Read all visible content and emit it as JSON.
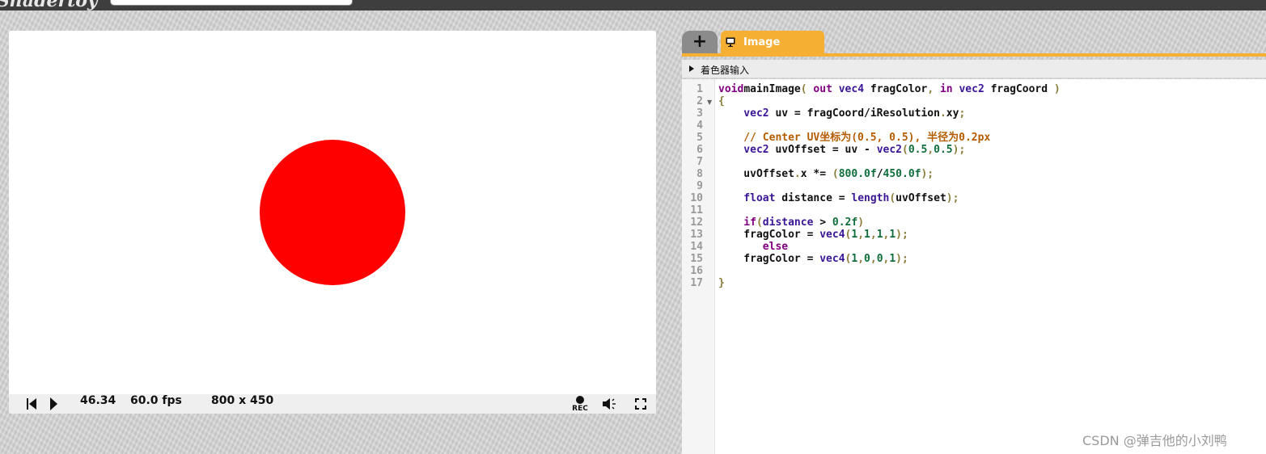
{
  "site": {
    "logo_fragment": "Shadertoy"
  },
  "player": {
    "time": "46.34",
    "fps": "60.0 fps",
    "resolution": "800 x 450",
    "rec_label": "REC",
    "circle_color": "#ff0000"
  },
  "editor": {
    "add_tab": "+",
    "tab_label": "Image",
    "input_header": "着色器输入",
    "accent": "#f5af32",
    "line_numbers": [
      "1",
      "2",
      "3",
      "4",
      "5",
      "6",
      "7",
      "8",
      "9",
      "10",
      "11",
      "12",
      "13",
      "14",
      "15",
      "16",
      "17"
    ],
    "code_lines": [
      [
        [
          "kw",
          "void"
        ],
        [
          "",
          "mainImage"
        ],
        [
          "pn",
          "( "
        ],
        [
          "kw",
          "out"
        ],
        [
          "",
          ""
        ],
        [
          "ty",
          " vec4"
        ],
        [
          "",
          " fragColor"
        ],
        [
          "pn",
          ","
        ],
        [
          "kw",
          " in"
        ],
        [
          "ty",
          " vec2"
        ],
        [
          "",
          " fragCoord "
        ],
        [
          "pn",
          ")"
        ]
      ],
      [
        [
          "pn",
          "{"
        ]
      ],
      [
        [
          "",
          ""
        ],
        [
          "ty",
          "    vec2"
        ],
        [
          "",
          " uv = fragCoord/iResolution"
        ],
        [
          "pn",
          "."
        ],
        [
          "",
          "xy"
        ],
        [
          "pn",
          ";"
        ]
      ],
      [],
      [
        [
          "cm",
          "    // Center UV坐标为(0.5, 0.5), 半径为0.2px"
        ]
      ],
      [
        [
          "ty",
          "    vec2"
        ],
        [
          "",
          " uvOffset = uv - "
        ],
        [
          "ty",
          "vec2"
        ],
        [
          "pn",
          "("
        ],
        [
          "nm",
          "0.5"
        ],
        [
          "pn",
          ","
        ],
        [
          "nm",
          "0.5"
        ],
        [
          "pn",
          ");"
        ]
      ],
      [],
      [
        [
          "",
          "    uvOffset"
        ],
        [
          "pn",
          "."
        ],
        [
          "",
          "x *= "
        ],
        [
          "pn",
          "("
        ],
        [
          "nm",
          "800.0f"
        ],
        [
          "",
          "/"
        ],
        [
          "nm",
          "450.0f"
        ],
        [
          "pn",
          ");"
        ]
      ],
      [],
      [
        [
          "ty",
          "    float"
        ],
        [
          "",
          " distance = "
        ],
        [
          "ty",
          "length"
        ],
        [
          "pn",
          "("
        ],
        [
          "",
          "uvOffset"
        ],
        [
          "pn",
          ");"
        ]
      ],
      [],
      [
        [
          "kw",
          "    if"
        ],
        [
          "pn",
          "("
        ],
        [
          "ty",
          "distance"
        ],
        [
          "",
          " > "
        ],
        [
          "nm",
          "0.2f"
        ],
        [
          "pn",
          ")"
        ]
      ],
      [
        [
          "",
          "    fragColor = "
        ],
        [
          "ty",
          "vec4"
        ],
        [
          "pn",
          "("
        ],
        [
          "nm",
          "1"
        ],
        [
          "pn",
          ","
        ],
        [
          "nm",
          "1"
        ],
        [
          "pn",
          ","
        ],
        [
          "nm",
          "1"
        ],
        [
          "pn",
          ","
        ],
        [
          "nm",
          "1"
        ],
        [
          "pn",
          ");"
        ]
      ],
      [
        [
          "kw",
          "       else"
        ]
      ],
      [
        [
          "",
          "    fragColor = "
        ],
        [
          "ty",
          "vec4"
        ],
        [
          "pn",
          "("
        ],
        [
          "nm",
          "1"
        ],
        [
          "pn",
          ","
        ],
        [
          "nm",
          "0"
        ],
        [
          "pn",
          ","
        ],
        [
          "nm",
          "0"
        ],
        [
          "pn",
          ","
        ],
        [
          "nm",
          "1"
        ],
        [
          "pn",
          ");"
        ]
      ],
      [],
      [
        [
          "pn",
          "}"
        ]
      ]
    ]
  },
  "watermark": "CSDN @弹吉他的小刘鸭"
}
